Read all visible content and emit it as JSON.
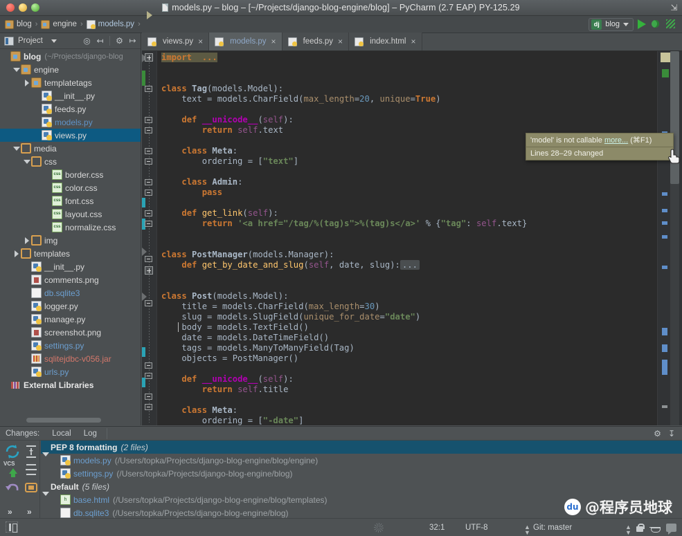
{
  "window": {
    "title": "models.py – blog – [~/Projects/django-blog-engine/blog] – PyCharm (2.7 EAP) PY-125.29",
    "lights": [
      "close",
      "minimize",
      "zoom"
    ]
  },
  "navbar": {
    "crumbs": [
      {
        "label": "blog",
        "icon": "folder-icon",
        "type": "folder"
      },
      {
        "label": "engine",
        "icon": "folder-icon",
        "type": "folder"
      },
      {
        "label": "models.py",
        "icon": "python-file-icon",
        "type": "py"
      }
    ],
    "run_config": {
      "badge": "dj",
      "label": "blog"
    },
    "buttons": [
      "run-icon",
      "debug-icon",
      "coverage-icon"
    ]
  },
  "project_panel": {
    "title": "Project",
    "toolbar_icons": [
      "target-icon",
      "collapse-all-icon",
      "gear-icon",
      "hide-icon"
    ],
    "tree": [
      {
        "depth": 0,
        "twisty": "none",
        "icon": "folder-source-icon",
        "label": "blog",
        "style": "root",
        "path": "(~/Projects/django-blog"
      },
      {
        "depth": 1,
        "twisty": "open",
        "icon": "folder-source-icon",
        "label": "engine",
        "style": "white"
      },
      {
        "depth": 2,
        "twisty": "closed",
        "icon": "folder-source-icon",
        "label": "templatetags",
        "style": "white"
      },
      {
        "depth": 3,
        "twisty": "none",
        "icon": "python-file-icon",
        "label": "__init__.py",
        "style": "white"
      },
      {
        "depth": 3,
        "twisty": "none",
        "icon": "python-file-icon",
        "label": "feeds.py",
        "style": "white"
      },
      {
        "depth": 3,
        "twisty": "none",
        "icon": "python-file-icon",
        "label": "models.py",
        "style": "blue-d"
      },
      {
        "depth": 3,
        "twisty": "none",
        "icon": "python-file-icon",
        "label": "views.py",
        "style": "white",
        "selected": true
      },
      {
        "depth": 1,
        "twisty": "open",
        "icon": "folder-plain-icon",
        "label": "media",
        "style": "white"
      },
      {
        "depth": 2,
        "twisty": "open",
        "icon": "folder-plain-icon",
        "label": "css",
        "style": "white"
      },
      {
        "depth": 4,
        "twisty": "none",
        "icon": "css-file-icon",
        "label": "border.css",
        "style": "white"
      },
      {
        "depth": 4,
        "twisty": "none",
        "icon": "css-file-icon",
        "label": "color.css",
        "style": "white"
      },
      {
        "depth": 4,
        "twisty": "none",
        "icon": "css-file-icon",
        "label": "font.css",
        "style": "white"
      },
      {
        "depth": 4,
        "twisty": "none",
        "icon": "css-file-icon",
        "label": "layout.css",
        "style": "white"
      },
      {
        "depth": 4,
        "twisty": "none",
        "icon": "css-file-icon",
        "label": "normalize.css",
        "style": "white"
      },
      {
        "depth": 2,
        "twisty": "closed",
        "icon": "folder-plain-icon",
        "label": "img",
        "style": "white"
      },
      {
        "depth": 1,
        "twisty": "closed",
        "icon": "folder-plain-icon",
        "label": "templates",
        "style": "white"
      },
      {
        "depth": 2,
        "twisty": "none",
        "icon": "python-file-icon",
        "label": "__init__.py",
        "style": "white"
      },
      {
        "depth": 2,
        "twisty": "none",
        "icon": "png-file-icon",
        "label": "comments.png",
        "style": "white"
      },
      {
        "depth": 2,
        "twisty": "none",
        "icon": "db-file-icon",
        "label": "db.sqlite3",
        "style": "blue"
      },
      {
        "depth": 2,
        "twisty": "none",
        "icon": "python-file-icon",
        "label": "logger.py",
        "style": "white"
      },
      {
        "depth": 2,
        "twisty": "none",
        "icon": "python-file-icon",
        "label": "manage.py",
        "style": "white"
      },
      {
        "depth": 2,
        "twisty": "none",
        "icon": "png-file-icon",
        "label": "screenshot.png",
        "style": "white"
      },
      {
        "depth": 2,
        "twisty": "none",
        "icon": "python-file-icon",
        "label": "settings.py",
        "style": "blue"
      },
      {
        "depth": 2,
        "twisty": "none",
        "icon": "jar-file-icon",
        "label": "sqlitejdbc-v056.jar",
        "style": "red"
      },
      {
        "depth": 2,
        "twisty": "none",
        "icon": "python-file-icon",
        "label": "urls.py",
        "style": "blue"
      },
      {
        "depth": 0,
        "twisty": "none",
        "icon": "libraries-icon",
        "label": "External Libraries",
        "style": "lib"
      }
    ]
  },
  "editor": {
    "tabs": [
      {
        "label": "views.py",
        "icon": "python-file-icon",
        "active": false,
        "modified": false
      },
      {
        "label": "models.py",
        "icon": "python-file-icon",
        "active": true,
        "modified": true
      },
      {
        "label": "feeds.py",
        "icon": "python-file-icon",
        "active": false,
        "modified": false
      },
      {
        "label": "index.html",
        "icon": "html-file-icon",
        "active": false,
        "modified": false
      }
    ],
    "close_glyph": "×",
    "code_lines": [
      "import ...",
      "",
      "",
      "class Tag(models.Model):",
      "    text = models.CharField(max_length=20, unique=True)",
      "",
      "    def __unicode__(self):",
      "        return self.text",
      "",
      "    class Meta:",
      "        ordering = [\"text\"]",
      "",
      "    class Admin:",
      "        pass",
      "",
      "    def get_link(self):",
      "        return '<a href=\"/tag/%(tag)s\">%(tag)s</a>' % {\"tag\": self.text}",
      "",
      "",
      "class PostManager(models.Manager):",
      "    def get_by_date_and_slug(self, date, slug):...",
      "",
      "",
      "class Post(models.Model):",
      "    title = models.CharField(max_length=30)",
      "    slug = models.SlugField(unique_for_date=\"date\")",
      "    body = models.TextField()",
      "    date = models.DateTimeField()",
      "    tags = models.ManyToManyField(Tag)",
      "    objects = PostManager()",
      "",
      "    def __unicode__(self):",
      "        return self.title",
      "",
      "    class Meta:",
      "        ordering = [\"-date\"]"
    ],
    "fold_placeholder": "..."
  },
  "tooltip": {
    "message": "'model' is not callable",
    "more_link": "more...",
    "shortcut": "(⌘F1)",
    "change_info": "Lines 28–29 changed"
  },
  "changes_panel": {
    "label": "Changes:",
    "tabs": [
      "Local",
      "Log"
    ],
    "sidebar_icons": [
      "refresh-icon",
      "vcs-up-icon",
      "rollback-icon",
      "expand-all-icon",
      "collapse-all-icon",
      "group-by-icon",
      "more-icon",
      "more-icon-2"
    ],
    "sidebar_label": "VCS",
    "header_icons": [
      "gear-icon",
      "hide-icon"
    ],
    "groups": [
      {
        "name": "PEP 8 formatting",
        "count": "(2 files)",
        "selected": true,
        "files": [
          {
            "name": "models.py",
            "icon": "python-file-icon",
            "path": "(/Users/topka/Projects/django-blog-engine/blog/engine)"
          },
          {
            "name": "settings.py",
            "icon": "python-file-icon",
            "path": "(/Users/topka/Projects/django-blog-engine/blog)"
          }
        ]
      },
      {
        "name": "Default",
        "count": "(5 files)",
        "selected": false,
        "files": [
          {
            "name": "base.html",
            "icon": "html-file-icon",
            "path": "(/Users/topka/Projects/django-blog-engine/blog/templates)"
          },
          {
            "name": "db.sqlite3",
            "icon": "db-file-icon",
            "path": "(/Users/topka/Projects/django-blog-engine/blog)"
          }
        ]
      }
    ]
  },
  "statusbar": {
    "caret_position": "32:1",
    "encoding": "UTF-8",
    "vcs_branch": "Git: master",
    "icons": [
      "spinner-icon",
      "lock-icon",
      "inspections-icon",
      "event-log-icon"
    ]
  },
  "watermark": {
    "handle": "@程序员地球",
    "badge": "du"
  },
  "colors": {
    "window_bg": "#4e5254",
    "editor_bg": "#2b2b2b",
    "gutter_bg": "#313335",
    "selection_blue": "#0d5a82",
    "changes_selection": "#16526e",
    "tooltip_bg": "#8c8a68",
    "accent_green": "#35b23c",
    "keyword_orange": "#cc7832",
    "string_green": "#6a8759",
    "number_blue": "#6897bb",
    "function_yellow": "#ffc66d",
    "kwarg_tan": "#aa8f6c",
    "self_purple": "#94558d",
    "magic_magenta": "#b200b2",
    "link_blue": "#6c9fd0",
    "jar_red": "#d4786b"
  }
}
